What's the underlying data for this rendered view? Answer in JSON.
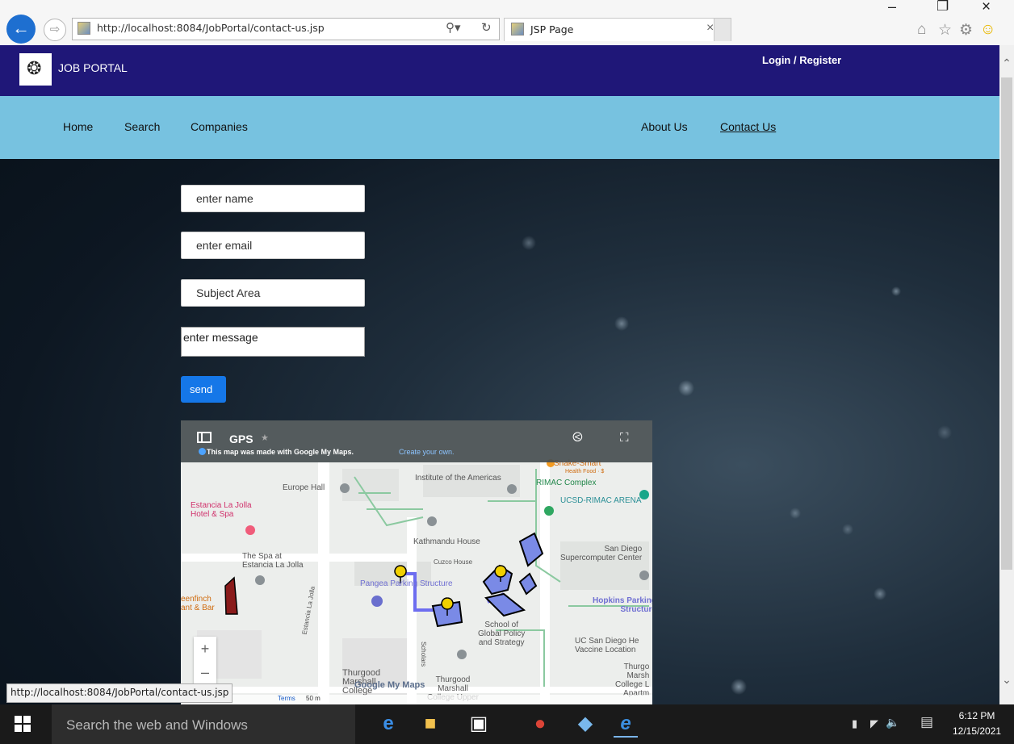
{
  "browser": {
    "address_url": "http://localhost:8084/JobPortal/contact-us.jsp",
    "tab_title": "JSP Page",
    "status_url": "http://localhost:8084/JobPortal/contact-us.jsp",
    "icons": [
      "back-icon",
      "forward-icon",
      "search-icon",
      "refresh-icon",
      "close-icon",
      "home-icon",
      "star-icon",
      "gear-icon",
      "smiley-icon"
    ]
  },
  "site": {
    "brand": "JOB PORTAL",
    "login_label": "Login / Register",
    "nav": {
      "home": "Home",
      "search": "Search",
      "companies": "Companies",
      "about": "About Us",
      "contact": "Contact Us"
    },
    "colors": {
      "header": "#1f1778",
      "navbar": "#77c2e0",
      "send_button": "#1577e8"
    }
  },
  "form": {
    "name_placeholder": "enter name",
    "email_placeholder": "enter email",
    "subject_placeholder": "Subject Area",
    "message_placeholder": "enter message",
    "send_label": "send"
  },
  "map": {
    "title": "GPS",
    "subtitle": "This map was made with Google My Maps.",
    "create_link": "Create your own.",
    "labels": {
      "institute": "Institute of the Americas",
      "europe_hall": "Europe Hall",
      "estancia": "Estancia La Jolla\nHotel & Spa",
      "spa": "The Spa at\nEstancia La Jolla",
      "kathmandu": "Kathmandu House",
      "cuzco": "Cuzco House",
      "pangea": "Pangea Parking Structure",
      "rimac": "RIMAC Complex",
      "rimac_arena": "UCSD-RIMAC ARENA",
      "snake": "Snake-Smart",
      "snake_sub": "Health Food · $",
      "supercomputer": "San Diego\nSupercomputer Center",
      "hopkins": "Hopkins Parking\nStructure",
      "school": "School of\nGlobal Policy\nand Strategy",
      "vaccine": "UC San Diego He\nVaccine Location",
      "thurgood_left": "Thurgood\nMarshall\nCollege",
      "thurgood_mid": "Thurgood\nMarshall\nCollege Upper",
      "thurgood_right": "Thurgo\nMarsh\nCollege L\nApartm",
      "eenfinch": "eenfinch\nant & Bar",
      "estancia_road": "Estancia La Jolla",
      "scholars_road": "Scholars",
      "google_logo": "Google My Maps",
      "terms": "Terms",
      "scale": "50 m"
    }
  },
  "taskbar": {
    "search_text": "Search the web and Windows",
    "time": "6:12 PM",
    "date": "12/15/2021"
  }
}
